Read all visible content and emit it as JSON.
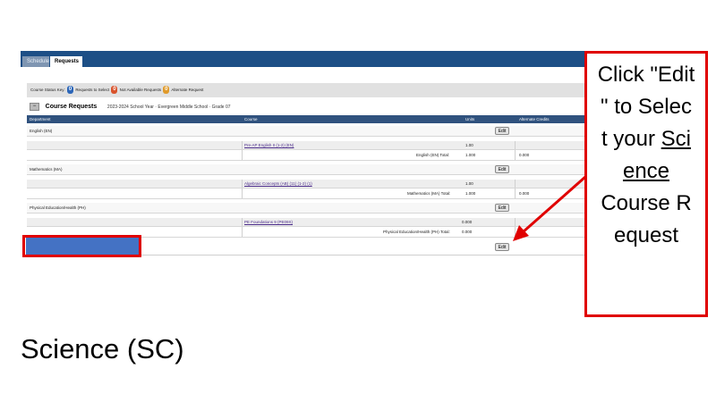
{
  "tabs": [
    {
      "label": "Schedule",
      "active": false
    },
    {
      "label": "Requests",
      "active": true
    }
  ],
  "summary": {
    "prefix": "Course Status Key:",
    "count_required": "0",
    "label_required": "Requests to Select",
    "count_warning": "0",
    "label_warning": "Not Available Requests",
    "count_alt": "0",
    "label_alt": "Alternate Request"
  },
  "course_requests": {
    "toggle": "−",
    "title": "Course Requests",
    "meta": "2023-2024 School Year · Evergreen Middle School · Grade 07"
  },
  "columns": {
    "department": "Department",
    "course": "Course",
    "units": "Units",
    "alternate": "Alternate Credits"
  },
  "departments": [
    {
      "name": "English (EN)",
      "course": "Pre-AP English II (1-2) (EN)",
      "course_units": "1.00",
      "total_label": "English (EN) Total:",
      "total_units": "1.000",
      "alt_units": "0.000",
      "edit_label": "Edit"
    },
    {
      "name": "Mathematics (MA)",
      "course": "Algebraic Concepts (AB) (11) (1-2) (1)",
      "course_units": "1.00",
      "total_label": "Mathematics (MA) Total:",
      "total_units": "1.000",
      "alt_units": "0.000",
      "edit_label": "Edit"
    },
    {
      "name": "Physical Education/Health (PH)",
      "course": "PE Foundations 9 (PE09X)",
      "course_units": "0.000",
      "total_label": "Physical Education/Health (PH) Total:",
      "total_units": "0.000",
      "alt_units": "",
      "edit_label": "Edit"
    }
  ],
  "science_edit_label": "Edit",
  "callout": {
    "line1": "Click \"Edit",
    "line2": "\" to Selec",
    "line3": "t your ",
    "underlined1": "Sci",
    "underlined2": "ence",
    "line5": "Course R",
    "line6": "equest"
  },
  "heading": "Science (SC)",
  "colors": {
    "accent_red": "#e00000",
    "header_blue": "#1d4f86",
    "highlight_blue": "#4472c4"
  }
}
